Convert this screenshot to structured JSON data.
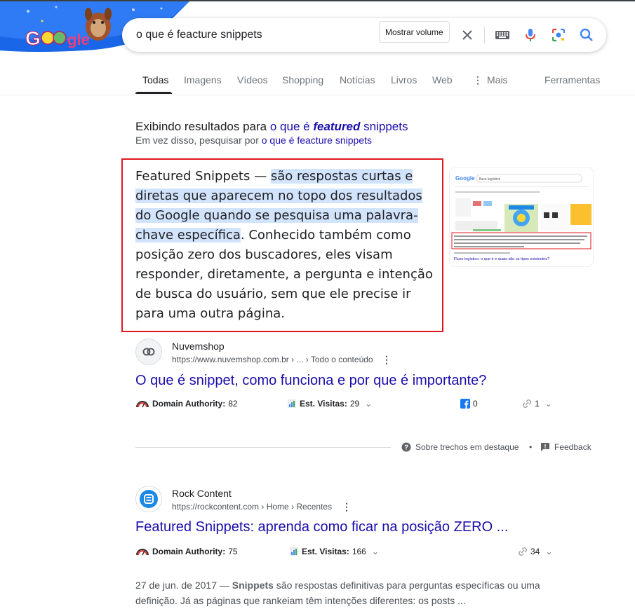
{
  "search": {
    "query": "o que é feacture snippets",
    "tooltip": "Mostrar volume"
  },
  "tabs": [
    {
      "label": "Todas",
      "active": true
    },
    {
      "label": "Imagens"
    },
    {
      "label": "Vídeos"
    },
    {
      "label": "Shopping"
    },
    {
      "label": "Notícias"
    },
    {
      "label": "Livros"
    },
    {
      "label": "Web"
    },
    {
      "label": "Mais"
    }
  ],
  "tools_label": "Ferramentas",
  "correction": {
    "showing_prefix": "Exibindo resultados para",
    "showing_query_part1": "o que é",
    "showing_query_bold": "featured",
    "showing_query_part2": "snippets",
    "instead_prefix": "Em vez disso, pesquisar por",
    "instead_query": "o que é feacture snippets"
  },
  "snippet": {
    "lead": "Featured Snippets — ",
    "highlight": "são respostas curtas e diretas que aparecem no topo dos resultados do Google quando se pesquisa uma palavra-chave específica",
    "rest": ". Conhecido também como posição zero dos buscadores, eles visam responder, diretamente, a pergunta e intenção de busca do usuário, sem que ele precise ir para uma outra página."
  },
  "results": [
    {
      "site": "Nuvemshop",
      "url": "https://www.nuvemshop.com.br › ... › Todo o conteúdo",
      "title": "O que é snippet, como funciona e por que é importante?",
      "domain_authority_label": "Domain Authority:",
      "domain_authority": "82",
      "visits_label": "Est. Visitas:",
      "visits": "29",
      "facebook": "0",
      "links": "1"
    },
    {
      "site": "Rock Content",
      "url": "https://rockcontent.com › Home › Recentes",
      "title": "Featured Snippets: aprenda como ficar na posição ZERO ...",
      "domain_authority_label": "Domain Authority:",
      "domain_authority": "75",
      "visits_label": "Est. Visitas:",
      "visits": "166",
      "links": "34",
      "date": "27 de jun. de 2017 —",
      "desc_bold": "Snippets",
      "desc_rest": " são respostas definitivas para perguntas específicas ou uma definição. Já as páginas que rankeiam têm intenções diferentes: os posts ..."
    }
  ],
  "feedback": {
    "about": "Sobre trechos em destaque",
    "sep": "•",
    "feedback": "Feedback"
  },
  "thumb": {
    "query": "fluxo logístico",
    "link_text": "Fluxo logístico: o que é e quais são os tipos existentes?"
  },
  "colors": {
    "link": "#1a0dab",
    "highlight": "#d2e3fc",
    "box_border": "#e0191f"
  }
}
